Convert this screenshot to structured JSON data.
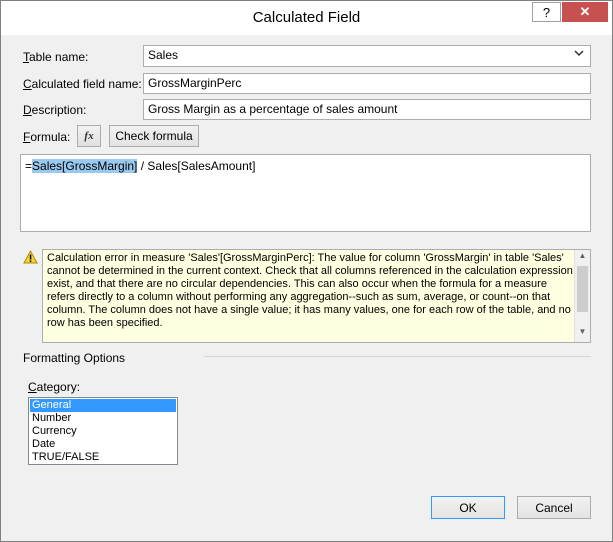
{
  "window": {
    "title": "Calculated Field",
    "help_glyph": "?",
    "close_glyph": "✕"
  },
  "table_name": {
    "label_accel": "T",
    "label_rest": "able name:",
    "value": "Sales"
  },
  "calc_field_name": {
    "label_accel": "C",
    "label_rest": "alculated field name:",
    "value": "GrossMarginPerc"
  },
  "description": {
    "label_accel": "D",
    "label_rest": "escription:",
    "value": "Gross Margin as a percentage of sales amount"
  },
  "formula": {
    "label_accel": "F",
    "label_rest": "ormula:",
    "fx_glyph": "fx",
    "check_label": "Check formula",
    "prefix": "=",
    "highlighted": "Sales[GrossMargin]",
    "suffix": " / Sales[SalesAmount]"
  },
  "error": {
    "message": "Calculation error in measure 'Sales'[GrossMarginPerc]: The value for column 'GrossMargin' in table 'Sales' cannot be determined in the current context. Check that all columns referenced in the calculation expression exist, and that there are no circular dependencies. This can also occur when the formula for a measure refers directly to a column without performing any aggregation--such as sum, average, or count--on that column. The column does not have a single value; it has many values, one for each row of the table, and no row has been specified."
  },
  "formatting": {
    "section_title": "Formatting Options",
    "category_label_accel": "C",
    "category_label_rest": "ategory:",
    "categories": [
      "General",
      "Number",
      "Currency",
      "Date",
      "TRUE/FALSE"
    ],
    "selected": "General"
  },
  "buttons": {
    "ok": "OK",
    "cancel": "Cancel"
  },
  "colors": {
    "selection": "#3399ff",
    "formula_highlight": "#99c9ef",
    "error_background": "#ffffe1",
    "close_button": "#c75050"
  }
}
